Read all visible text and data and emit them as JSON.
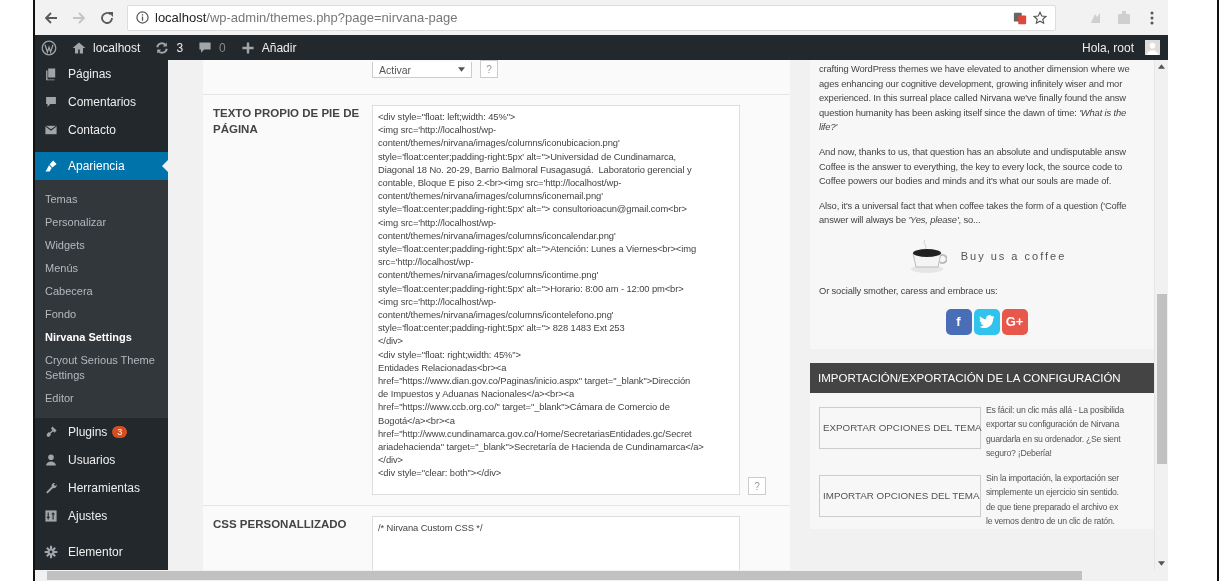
{
  "browser": {
    "url_host": "localhost",
    "url_path": "/wp-admin/themes.php?page=nirvana-page"
  },
  "admin_bar": {
    "site": "localhost",
    "updates": "3",
    "comments": "0",
    "new": "Añadir",
    "greeting": "Hola, root"
  },
  "sidebar": {
    "items": [
      {
        "label": "Páginas",
        "selected": false
      },
      {
        "label": "Comentarios",
        "selected": false
      },
      {
        "label": "Contacto",
        "selected": false
      },
      {
        "label": "Apariencia",
        "selected": true,
        "children": [
          {
            "label": "Temas",
            "selected": false
          },
          {
            "label": "Personalizar",
            "selected": false
          },
          {
            "label": "Widgets",
            "selected": false
          },
          {
            "label": "Menús",
            "selected": false
          },
          {
            "label": "Cabecera",
            "selected": false
          },
          {
            "label": "Fondo",
            "selected": false
          },
          {
            "label": "Nirvana Settings",
            "selected": true
          },
          {
            "label": "Cryout Serious Theme Settings",
            "selected": false
          },
          {
            "label": "Editor",
            "selected": false
          }
        ]
      },
      {
        "label": "Plugins",
        "badge": "3",
        "selected": false
      },
      {
        "label": "Usuarios",
        "selected": false
      },
      {
        "label": "Herramientas",
        "selected": false
      },
      {
        "label": "Ajustes",
        "selected": false
      },
      {
        "label": "Elementor",
        "selected": false
      }
    ]
  },
  "settings": [
    {
      "kind": "select",
      "value": "Activar",
      "help": "?"
    },
    {
      "kind": "textarea",
      "label": "TEXTO PROPIO DE PIE DE PÁGINA",
      "help": "?",
      "lines": [
        "<div style=\"float: left;width: 45%\">",
        "<img src='http://localhost/wp-",
        "content/themes/nirvana/images/columns/iconubicacion.png'",
        "style='float:center;padding-right:5px' alt=''>Universidad de Cundinamarca,",
        "Diagonal 18 No. 20-29, Barrio Balmoral Fusagasugá.  Laboratorio gerencial y",
        "contable, Bloque E piso 2.<br><img src='http://localhost/wp-",
        "content/themes/nirvana/images/columns/iconemail.png'",
        "style='float:center;padding-right:5px' alt=''> consultorioacun@gmail.com<br>",
        "<img src='http://localhost/wp-",
        "content/themes/nirvana/images/columns/iconcalendar.png'",
        "style='float:center;padding-right:5px' alt=''>Atención: Lunes a Viernes<br><img",
        "src='http://localhost/wp-",
        "content/themes/nirvana/images/columns/icontime.png'",
        "style='float:center;padding-right:5px' alt=''>Horario: 8:00 am - 12:00 pm<br>",
        "<img src='http://localhost/wp-",
        "content/themes/nirvana/images/columns/icontelefono.png'",
        "style='float:center;padding-right:5px' alt=''> 828 1483 Ext 253",
        "</div>",
        "<div style=\"float: right;width: 45%\">",
        "Entidades Relacionadas<br><a",
        "href=\"https://www.dian.gov.co/Paginas/inicio.aspx\" target=\"_blank\">Dirección",
        "de Impuestos y Aduanas Nacionales</a><br><a",
        "href=\"https://www.ccb.org.co/\" target=\"_blank\">Cámara de Comercio de",
        "Bogotá</a><br><a",
        "href=\"http://www.cundinamarca.gov.co/Home/SecretariasEntidades.gc/Secret",
        "ariadehacienda\" target=\"_blank\">Secretaría de Hacienda de Cundinamarca</a>",
        "</div>",
        "<div style=\"clear: both\"></div>"
      ]
    },
    {
      "kind": "textarea",
      "label": "CSS PERSONALLIZADO",
      "lines": [
        "/* Nirvana Custom CSS */"
      ]
    }
  ],
  "about": {
    "paragraphs": [
      [
        "crafting WordPress themes we have elevated to another dimension where we",
        "ages enhancing our cognitive development, growing infinitely wiser and mor",
        "experienced. In this surreal place called Nirvana we've finally found the answ",
        "question humanity has been asking itself since the dawn of time: *'What is the*",
        "*life?'*"
      ],
      [
        "And now, thanks to us, that question has an absolute and undisputable answ",
        "Coffee is the answer to everything, the key to every lock, the source code to",
        "Coffee powers our bodies and minds and it's what our souls are made of."
      ],
      [
        "Also, it's a universal fact that when coffee takes the form of a question ('Coffe",
        "answer will always be *'Yes, please'*, so..."
      ]
    ],
    "coffee_link": "Buy us a coffee",
    "social_prompt": "Or socially smother, caress and embrace us:",
    "social": [
      {
        "label": "f",
        "color": "#4a6eb6"
      },
      {
        "color": "#2fc3ee"
      },
      {
        "label": "G+",
        "color": "#e8574b"
      }
    ]
  },
  "import_export": {
    "title": "IMPORTACIÓN/EXPORTACIÓN DE LA CONFIGURACIÓN",
    "actions": [
      {
        "button": "EXPORTAR OPCIONES DEL TEMA",
        "description": [
          "Es fácil: un clic más allá - La posibilida",
          "exportar su configuración de Nirvana",
          "guardarla en su ordenador. ¿Se sient",
          "seguro? ¡Debería!"
        ]
      },
      {
        "button": "IMPORTAR OPCIONES DEL TEMA",
        "description": [
          "Sin la importación, la exportación ser",
          "simplemente un ejercicio sin sentido.",
          "de que tiene preparado el archivo ex",
          "le vemos dentro de un clic de ratón."
        ]
      }
    ]
  }
}
